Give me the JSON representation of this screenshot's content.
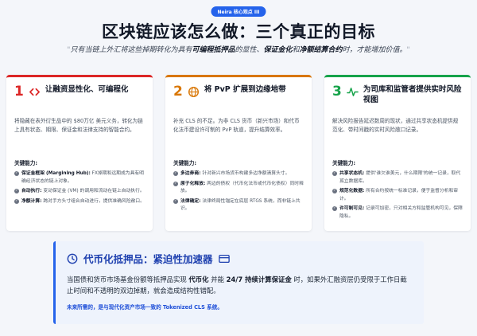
{
  "badge": "Neira 核心观点 III",
  "title": "区块链应该怎么做：三个真正的目标",
  "subtitle": {
    "open_quote": "\"",
    "part1": "只有当链上外汇将这些掉期转化为具有",
    "bold1": "可编程抵押品",
    "part2": "的显性、",
    "bold2": "保证金化",
    "part3": "和",
    "bold3": "净额结算合约",
    "part4": "时，才能增加价值。",
    "close_quote": "\""
  },
  "colors": {
    "card1": "#dc2626",
    "card2": "#d97706",
    "card3": "#16a34a",
    "accent": "#2563eb",
    "badge_bg": "#2563eb",
    "bottom_bg": "#eef3fc"
  },
  "cards": [
    {
      "number": "1",
      "icon": "code-icon",
      "title": "让融资显性化、可编程化",
      "desc": {
        "text1": "将隐藏在表外衍生品中的 $80万亿 美元义务，转化为链上具有状态、期限、保证金和法律支持的智能合约。",
        "bold": ""
      },
      "key_title": "关键能力:",
      "items": [
        {
          "bold": "保证金框架 (Margining Hub):",
          "text": " FX掉期和远期成为具有明确经济状态的链上对象。"
        },
        {
          "bold": "自动执行:",
          "text": " 变动保证金 (VM) 的调用和流动在链上自动执行。"
        },
        {
          "bold": "净额计算:",
          "text": " 跨对手方头寸组合自动进行，提供准确风险敞口。"
        }
      ]
    },
    {
      "number": "2",
      "icon": "globe-icon",
      "title": "将 PvP 扩展到边缘地带",
      "desc": {
        "text1": "补充 CLS 的不足。为非 CLS 货币（新兴市场）和代币化法币建设许可制的 PvP 轨道，提升结算效率。",
        "bold": ""
      },
      "key_title": "关键能力:",
      "items": [
        {
          "bold": "多边券商:",
          "text": " 针对新兴市场货币构建多边净额清算头寸。"
        },
        {
          "bold": "原子化释放:",
          "text": " 两边的债权（代币化法币或代币化债权）同时释放。"
        },
        {
          "bold": "法律确定:",
          "text": " 法律终局性锚定在底层 RTGS 系统，而非链上共识。"
        }
      ]
    },
    {
      "number": "3",
      "icon": "pulse-icon",
      "title": "为司库和监管者提供实时风险视图",
      "desc": {
        "text1": "解决风险报告延迟数周的现状，通过共享状态机提供规范化、带时间戳的实时风险敞口记录。",
        "bold": ""
      },
      "key_title": "关键能力:",
      "items": [
        {
          "bold": "共享状态机:",
          "text": " 提供'谁欠谁美元，什么期限'的统一记录，取代孤立数据库。"
        },
        {
          "bold": "规范化数据:",
          "text": " 所有合约按统一标准记录，便于监督分析和审计。"
        },
        {
          "bold": "许可制可见:",
          "text": " 记录可加密，只对相关方和监管机构可见，保障隐私。"
        }
      ]
    }
  ],
  "bottom": {
    "title": "代币化抵押品：紧迫性加速器",
    "body_part1": "当国债和货币市场基金份额等抵押品实现 ",
    "body_bold1": "代币化",
    "body_part2": " 并能 ",
    "body_bold2": "24/7 持续计算保证金",
    "body_part3": " 时，如果外汇融资层仍受限于工作日截止时间和不透明的双边掉期，就会造成结构性错配。",
    "footer": "未来所需的，是与现代化资产市场一致的 Tokenized CLS 系统。"
  }
}
